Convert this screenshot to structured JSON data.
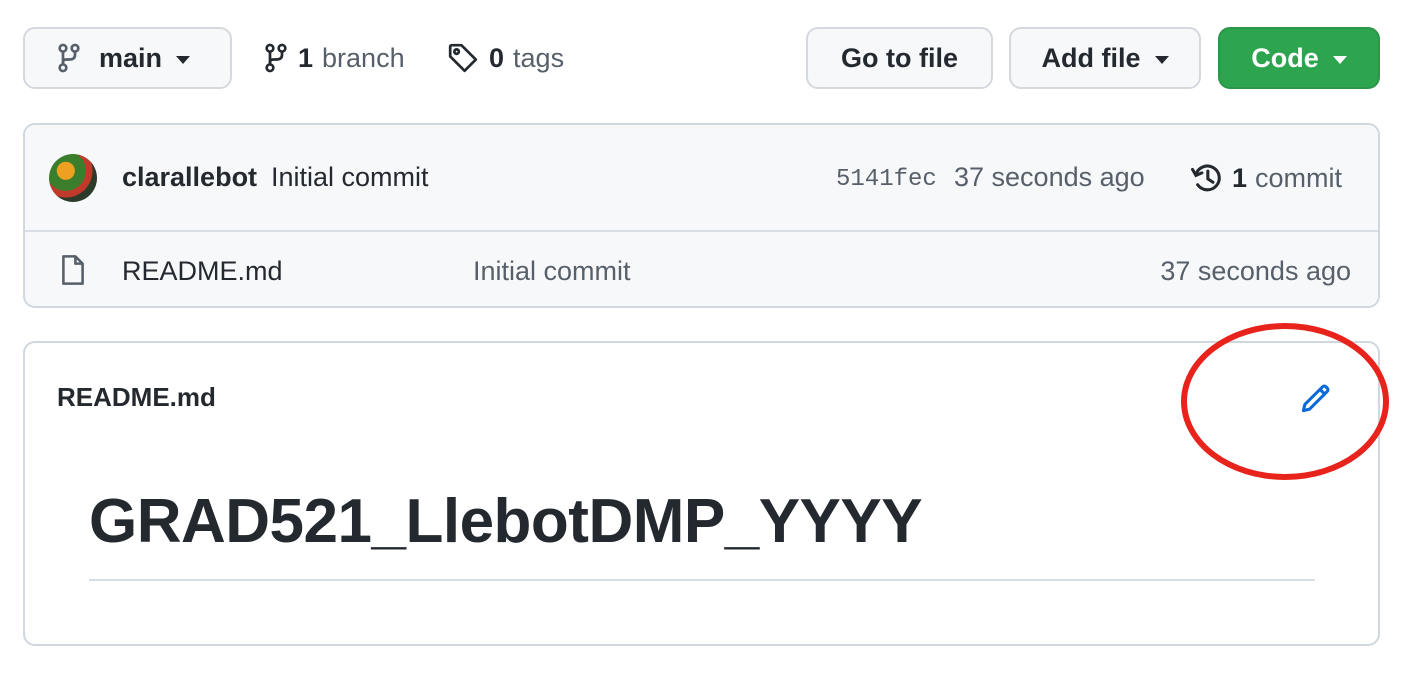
{
  "toolbar": {
    "branch_label": "main",
    "branch_count": "1",
    "branch_word": "branch",
    "tag_count": "0",
    "tag_word": "tags",
    "goto_file_label": "Go to file",
    "add_file_label": "Add file",
    "code_label": "Code"
  },
  "latest_commit": {
    "author": "clarallebot",
    "message": "Initial commit",
    "sha": "5141fec",
    "time": "37 seconds ago",
    "count": "1",
    "count_word": "commit"
  },
  "files": [
    {
      "name": "README.md",
      "commit_message": "Initial commit",
      "time": "37 seconds ago",
      "icon": "file-icon"
    }
  ],
  "readme": {
    "title": "README.md",
    "heading": "GRAD521_LlebotDMP_YYYY",
    "edit_icon": "pencil-icon"
  },
  "colors": {
    "accent_blue": "#0969da",
    "code_green": "#2da44e",
    "annotation_red": "#e8231c"
  }
}
